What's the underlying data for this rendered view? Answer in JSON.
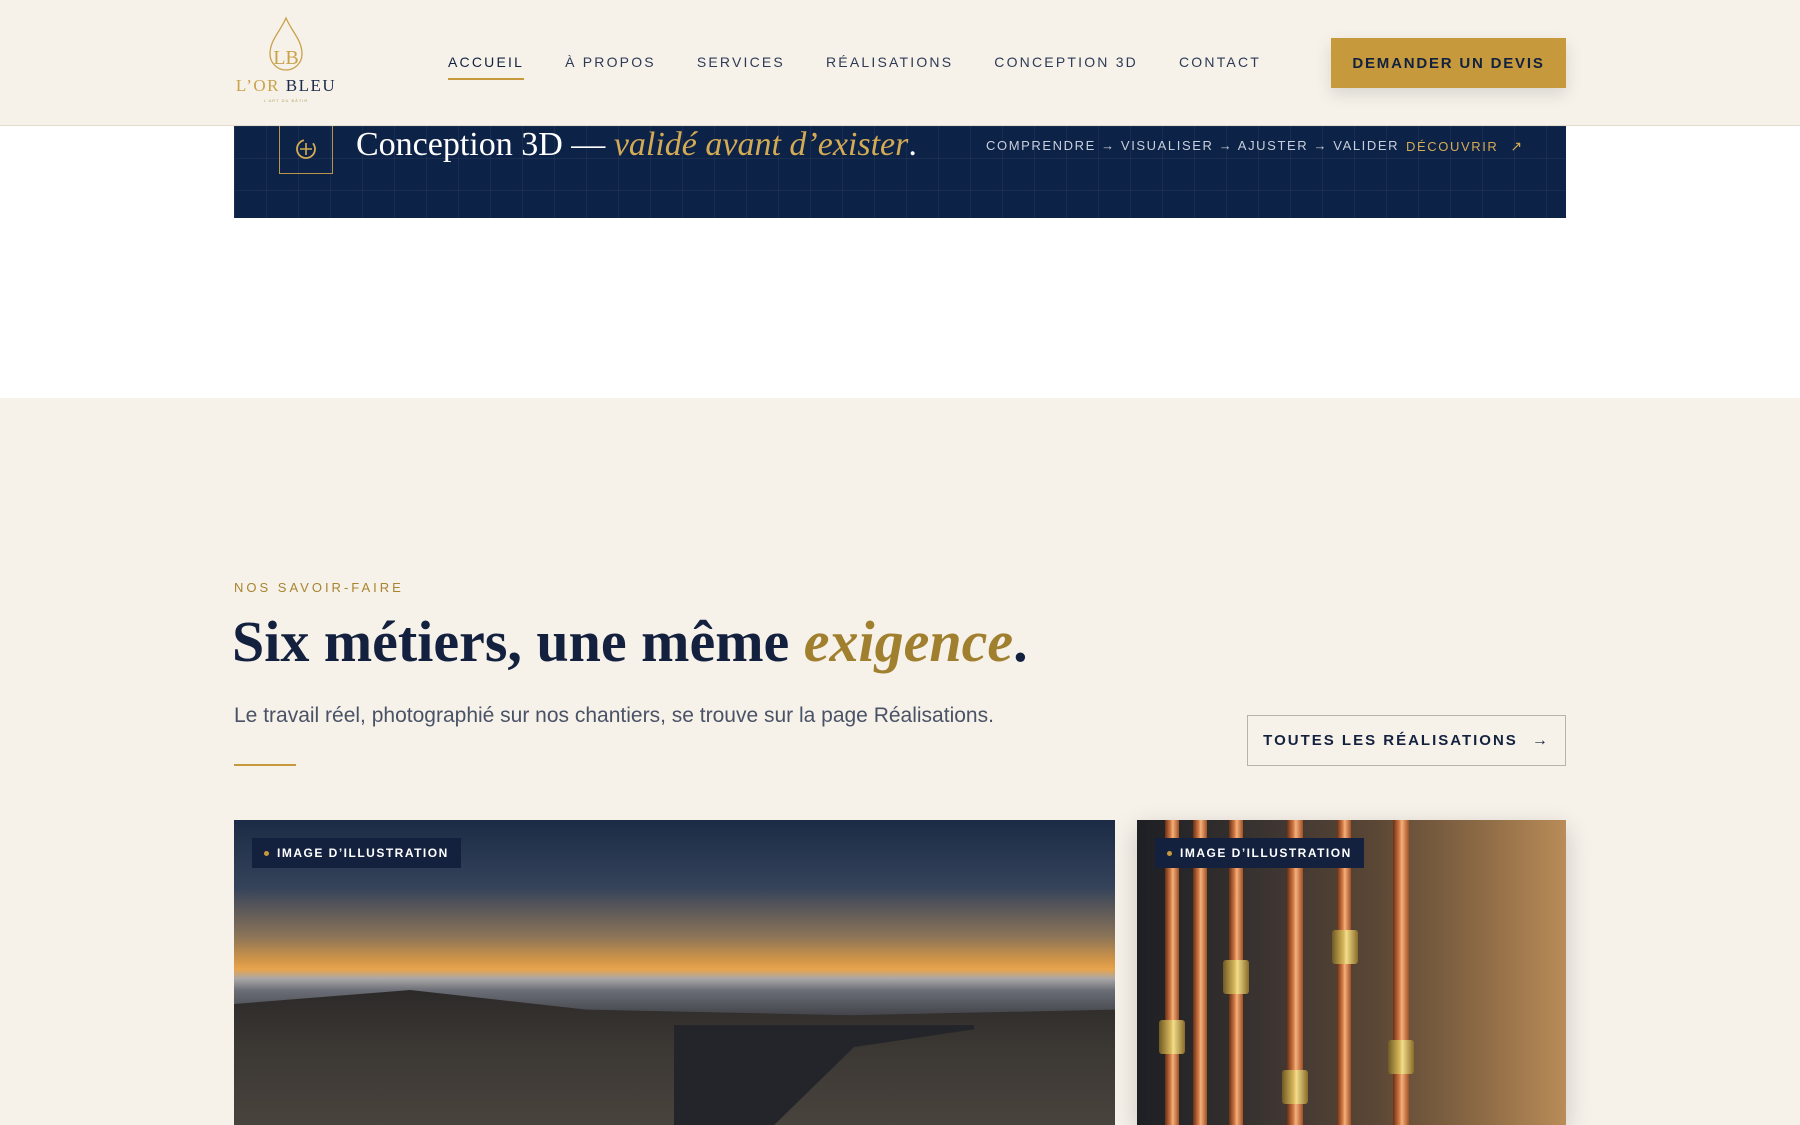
{
  "brand": {
    "name_gold": "L’OR",
    "name_dark": " BLEU",
    "monogram": "LB",
    "tagline": "L’ART DU BÂTIR"
  },
  "nav": {
    "items": [
      {
        "label": "ACCUEIL",
        "active": true
      },
      {
        "label": "À PROPOS"
      },
      {
        "label": "SERVICES"
      },
      {
        "label": "RÉALISATIONS"
      },
      {
        "label": "CONCEPTION 3D"
      },
      {
        "label": "CONTACT"
      }
    ],
    "cta_label": "DEMANDER UN DEVIS"
  },
  "banner": {
    "title_main": "Conception 3D — ",
    "title_em": "validé avant d’exister",
    "title_end": ".",
    "steps": "COMPRENDRE → VISUALISER → AJUSTER → VALIDER",
    "link_label": "DÉCOUVRIR",
    "link_icon": "arrow-up-right-icon"
  },
  "section": {
    "eyebrow": "NOS SAVOIR-FAIRE",
    "headline_main": "Six métiers, une même ",
    "headline_em": "exigence",
    "headline_end": ".",
    "subtitle": "Le travail réel, photographié sur nos chantiers, se trouve sur la page Réalisations.",
    "button_label": "TOUTES LES RÉALISATIONS",
    "button_icon": "arrow-right-icon"
  },
  "cards": [
    {
      "badge": "IMAGE D’ILLUSTRATION"
    },
    {
      "badge": "IMAGE D’ILLUSTRATION"
    }
  ],
  "colors": {
    "gold": "#c69a3c",
    "navy": "#0d2247",
    "cream": "#f6f2ea"
  }
}
